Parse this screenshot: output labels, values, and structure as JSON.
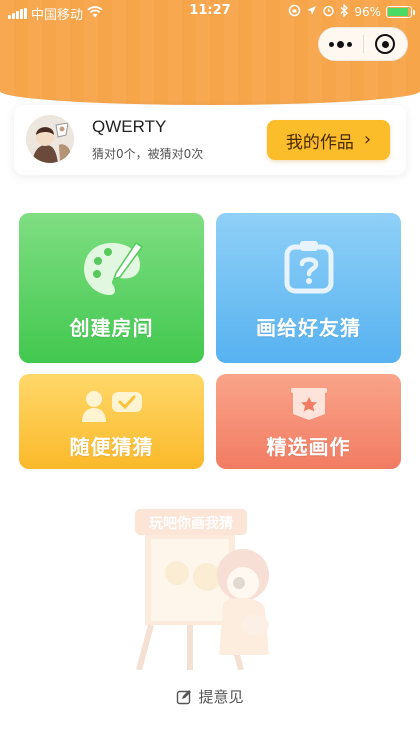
{
  "status_bar": {
    "carrier": "中国移动",
    "time": "11:27",
    "battery": "96%"
  },
  "profile": {
    "username": "QWERTY",
    "stats": "猜对0个，被猜对0次",
    "works_button": "我的作品"
  },
  "tiles": {
    "create_room": "创建房间",
    "draw_for_friends": "画给好友猜",
    "random_guess": "随便猜猜",
    "featured_works": "精选画作"
  },
  "illustration": {
    "sign_text": "玩吧你画我猜"
  },
  "footer": {
    "feedback": "提意见"
  },
  "colors": {
    "header": "#f7a54a",
    "works_button": "#fbbd2a",
    "create_room": "#4ccb55",
    "draw_for_friends": "#62b8f2",
    "random_guess": "#fcc03a",
    "featured_works": "#f38468"
  }
}
